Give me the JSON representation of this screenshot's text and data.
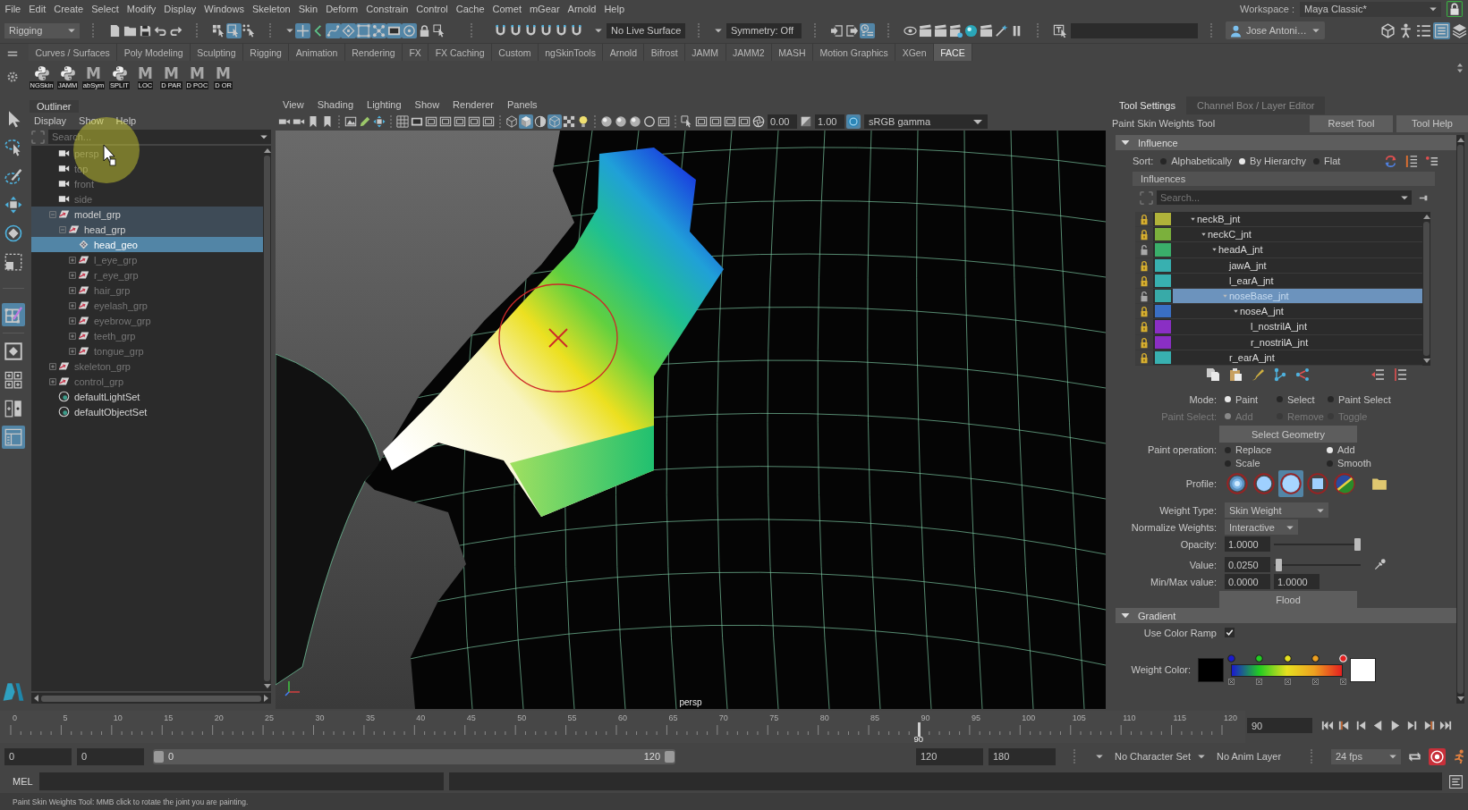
{
  "menu_bar": {
    "items": [
      "File",
      "Edit",
      "Create",
      "Select",
      "Modify",
      "Display",
      "Windows",
      "Skeleton",
      "Skin",
      "Deform",
      "Constrain",
      "Control",
      "Cache",
      "Comet",
      "mGear",
      "Arnold",
      "Help"
    ],
    "workspace_label": "Workspace :",
    "workspace": "Maya Classic*"
  },
  "status_line": {
    "menu_set": "Rigging",
    "selection_modes": [
      {
        "on": false
      },
      {
        "on": true
      },
      {
        "on": false
      }
    ],
    "mask_toggles": [
      {
        "on": true
      },
      {
        "on": false
      },
      {
        "on": true
      },
      {
        "on": true
      },
      {
        "on": true
      },
      {
        "on": true
      },
      {
        "on": true
      },
      {
        "on": true
      },
      {
        "on": false
      },
      {
        "on": false
      }
    ],
    "snap_toggles": [
      {
        "on": false
      },
      {
        "on": false
      },
      {
        "on": false
      },
      {
        "on": false
      },
      {
        "on": false
      },
      {
        "on": false
      }
    ],
    "live_surface": "No Live Surface",
    "symmetry": "Symmetry: Off",
    "history_toggles": [
      {
        "on": false
      },
      {
        "on": false
      },
      {
        "on": true
      }
    ],
    "user": "Jose Antoni…",
    "panel_toggles": [
      {
        "on": false
      },
      {
        "on": false
      },
      {
        "on": false
      },
      {
        "on": true
      },
      {
        "on": false
      }
    ]
  },
  "shelf": {
    "tabs": [
      {
        "label": "Curves / Surfaces",
        "selected": false
      },
      {
        "label": "Poly Modeling",
        "selected": false
      },
      {
        "label": "Sculpting",
        "selected": false
      },
      {
        "label": "Rigging",
        "selected": false
      },
      {
        "label": "Animation",
        "selected": false
      },
      {
        "label": "Rendering",
        "selected": false
      },
      {
        "label": "FX",
        "selected": false
      },
      {
        "label": "FX Caching",
        "selected": false
      },
      {
        "label": "Custom",
        "selected": false
      },
      {
        "label": "ngSkinTools",
        "selected": false
      },
      {
        "label": "Arnold",
        "selected": false
      },
      {
        "label": "Bifrost",
        "selected": false
      },
      {
        "label": "JAMM",
        "selected": false
      },
      {
        "label": "JAMM2",
        "selected": false
      },
      {
        "label": "MASH",
        "selected": false
      },
      {
        "label": "Motion Graphics",
        "selected": false
      },
      {
        "label": "XGen",
        "selected": false
      },
      {
        "label": "FACE",
        "selected": true
      }
    ],
    "buttons": [
      {
        "label": "NGSkin",
        "kind": "python"
      },
      {
        "label": "JAMM",
        "kind": "python"
      },
      {
        "label": "abSym",
        "kind": "mel",
        "glyph": "M"
      },
      {
        "label": "SPLIT",
        "kind": "python"
      },
      {
        "label": "LOC",
        "kind": "mel",
        "glyph": "M"
      },
      {
        "label": "D PAR",
        "kind": "mel",
        "glyph": "M"
      },
      {
        "label": "D POC",
        "kind": "mel",
        "glyph": "M"
      },
      {
        "label": "D OR",
        "kind": "mel",
        "glyph": "M"
      }
    ]
  },
  "toolbox": {
    "tools": [
      {
        "selected": false
      },
      {
        "selected": false
      },
      {
        "selected": false
      },
      {
        "selected": false
      },
      {
        "selected": false
      },
      {
        "selected": false
      },
      {
        "selected": true
      }
    ],
    "layouts": [
      {
        "selected": false
      },
      {
        "selected": false
      },
      {
        "selected": false
      },
      {
        "selected": true
      }
    ]
  },
  "outliner": {
    "title": "Outliner",
    "menu": [
      "Display",
      "Show",
      "Help"
    ],
    "search_placeholder": "Search...",
    "items": [
      {
        "name": "persp",
        "kind": "camera",
        "hidden": true,
        "selected": false,
        "highlighted": false
      },
      {
        "name": "top",
        "kind": "camera",
        "hidden": true,
        "selected": false,
        "highlighted": false
      },
      {
        "name": "front",
        "kind": "camera",
        "hidden": true,
        "selected": false,
        "highlighted": false
      },
      {
        "name": "side",
        "kind": "camera",
        "hidden": true,
        "selected": false,
        "highlighted": false
      },
      {
        "name": "model_grp",
        "kind": "group",
        "hidden": false,
        "selected": false,
        "highlighted": true,
        "expanded": true,
        "children": [
          {
            "name": "head_grp",
            "kind": "group",
            "hidden": false,
            "selected": false,
            "highlighted": true,
            "expanded": true,
            "children": [
              {
                "name": "head_geo",
                "kind": "mesh",
                "hidden": false,
                "selected": true,
                "highlighted": false
              },
              {
                "name": "l_eye_grp",
                "kind": "group",
                "hidden": true,
                "selected": false,
                "highlighted": false,
                "expanded": false
              },
              {
                "name": "r_eye_grp",
                "kind": "group",
                "hidden": true,
                "selected": false,
                "highlighted": false,
                "expanded": false
              },
              {
                "name": "hair_grp",
                "kind": "group",
                "hidden": true,
                "selected": false,
                "highlighted": false,
                "expanded": false
              },
              {
                "name": "eyelash_grp",
                "kind": "group",
                "hidden": true,
                "selected": false,
                "highlighted": false,
                "expanded": false
              },
              {
                "name": "eyebrow_grp",
                "kind": "group",
                "hidden": true,
                "selected": false,
                "highlighted": false,
                "expanded": false
              },
              {
                "name": "teeth_grp",
                "kind": "group",
                "hidden": true,
                "selected": false,
                "highlighted": false,
                "expanded": false
              },
              {
                "name": "tongue_grp",
                "kind": "group",
                "hidden": true,
                "selected": false,
                "highlighted": false,
                "expanded": false
              }
            ]
          }
        ]
      },
      {
        "name": "skeleton_grp",
        "kind": "group",
        "hidden": true,
        "selected": false,
        "highlighted": false,
        "expanded": false
      },
      {
        "name": "control_grp",
        "kind": "group",
        "hidden": true,
        "selected": false,
        "highlighted": false,
        "expanded": false
      },
      {
        "name": "defaultLightSet",
        "kind": "set",
        "hidden": false,
        "selected": false,
        "highlighted": false
      },
      {
        "name": "defaultObjectSet",
        "kind": "set",
        "hidden": false,
        "selected": false,
        "highlighted": false
      }
    ]
  },
  "viewport": {
    "menu": [
      "View",
      "Shading",
      "Lighting",
      "Show",
      "Renderer",
      "Panels"
    ],
    "toolbar_toggles": [
      {
        "on": false
      },
      {
        "on": false
      },
      {
        "on": false
      },
      {
        "on": false
      },
      {
        "on": false
      },
      {
        "on": false
      },
      {
        "on": false
      },
      {
        "on": false
      },
      {
        "on": false
      },
      {
        "on": false
      },
      {
        "on": false
      },
      {
        "on": false
      },
      {
        "on": false
      },
      {
        "on": false
      },
      {
        "on": false
      },
      {
        "on": true
      },
      {
        "on": false
      },
      {
        "on": true
      },
      {
        "on": false
      },
      {
        "on": false
      },
      {
        "on": false
      },
      {
        "on": false
      },
      {
        "on": false
      },
      {
        "on": false
      },
      {
        "on": false
      },
      {
        "on": false
      },
      {
        "on": false
      },
      {
        "on": false
      },
      {
        "on": false
      },
      {
        "on": false
      },
      {
        "on": false
      }
    ],
    "exposure": "0.00",
    "gamma": "1.00",
    "color_management": true,
    "color_space": "sRGB gamma",
    "camera": "persp"
  },
  "tool_settings": {
    "tabs": [
      {
        "label": "Tool Settings",
        "selected": true
      },
      {
        "label": "Channel Box / Layer Editor",
        "selected": false
      }
    ],
    "tool_name": "Paint Skin Weights Tool",
    "buttons": [
      "Reset Tool",
      "Tool Help"
    ],
    "influence": {
      "title": "Influence",
      "expanded": true,
      "sort_label": "Sort:",
      "sort_options": [
        {
          "label": "Alphabetically",
          "selected": false
        },
        {
          "label": "By Hierarchy",
          "selected": true
        },
        {
          "label": "Flat",
          "selected": false
        }
      ],
      "list_title": "Influences",
      "search_placeholder": "Search...",
      "joints": [
        {
          "name": "neckB_jnt",
          "locked": true,
          "color": "#b0b33a",
          "selected": false,
          "expanded": true,
          "children": [
            {
              "name": "neckC_jnt",
              "locked": true,
              "color": "#7bb03c",
              "selected": false,
              "expanded": true,
              "children": [
                {
                  "name": "headA_jnt",
                  "locked": false,
                  "color": "#3aae6a",
                  "selected": false,
                  "expanded": true,
                  "children": [
                    {
                      "name": "jawA_jnt",
                      "locked": true,
                      "color": "#38b0b0",
                      "selected": false
                    },
                    {
                      "name": "l_earA_jnt",
                      "locked": true,
                      "color": "#38b0b0",
                      "selected": false
                    },
                    {
                      "name": "noseBase_jnt",
                      "locked": false,
                      "color": "#38aaa8",
                      "selected": true,
                      "expanded": true,
                      "children": [
                        {
                          "name": "noseA_jnt",
                          "locked": true,
                          "color": "#3a6fc4",
                          "selected": false,
                          "expanded": true,
                          "children": [
                            {
                              "name": "l_nostrilA_jnt",
                              "locked": true,
                              "color": "#8a2fc4",
                              "selected": false
                            },
                            {
                              "name": "r_nostrilA_jnt",
                              "locked": true,
                              "color": "#8a2fc4",
                              "selected": false
                            }
                          ]
                        }
                      ]
                    },
                    {
                      "name": "r_earA_jnt",
                      "locked": true,
                      "color": "#38b0b0",
                      "selected": false
                    }
                  ]
                }
              ]
            }
          ]
        }
      ],
      "mode": {
        "label": "Mode:",
        "options": [
          {
            "label": "Paint",
            "selected": true
          },
          {
            "label": "Select",
            "selected": false
          },
          {
            "label": "Paint Select",
            "selected": false
          }
        ]
      },
      "paint_select": {
        "label": "Paint Select:",
        "disabled": true,
        "options": [
          {
            "label": "Add",
            "selected": true
          },
          {
            "label": "Remove",
            "selected": false
          },
          {
            "label": "Toggle",
            "selected": false
          }
        ]
      },
      "select_geometry": "Select Geometry",
      "paint_operation": {
        "label": "Paint operation:",
        "options": [
          {
            "label": "Replace",
            "selected": false
          },
          {
            "label": "Add",
            "selected": true
          },
          {
            "label": "Scale",
            "selected": false
          },
          {
            "label": "Smooth",
            "selected": false
          }
        ]
      },
      "profile": {
        "label": "Profile:",
        "brushes": [
          {
            "selected": false
          },
          {
            "selected": false
          },
          {
            "selected": true
          },
          {
            "selected": false
          }
        ]
      },
      "weight_type": {
        "label": "Weight Type:",
        "value": "Skin Weight"
      },
      "normalize_weights": {
        "label": "Normalize Weights:",
        "value": "Interactive"
      },
      "opacity": {
        "label": "Opacity:",
        "value": "1.0000",
        "level": 1
      },
      "value": {
        "label": "Value:",
        "value": "0.0250",
        "level": 0.025
      },
      "min_max": {
        "label": "Min/Max value:",
        "min": "0.0000",
        "max": "1.0000"
      },
      "flood": "Flood"
    },
    "gradient": {
      "title": "Gradient",
      "expanded": true,
      "use_color_ramp": {
        "label": "Use Color Ramp",
        "checked": true
      },
      "weight_color_label": "Weight Color:",
      "ramp_markers": [
        {
          "color": "#1a1ad0",
          "selected": false
        },
        {
          "color": "#22cc22",
          "selected": false
        },
        {
          "color": "#e6e020",
          "selected": false
        },
        {
          "color": "#eea020",
          "selected": false
        },
        {
          "color": "#e42020",
          "selected": true
        }
      ]
    }
  },
  "timeline": {
    "tick_labels": [
      "0",
      "5",
      "10",
      "15",
      "20",
      "25",
      "30",
      "35",
      "40",
      "45",
      "50",
      "55",
      "60",
      "65",
      "70",
      "75",
      "80",
      "85",
      "90",
      "95",
      "100",
      "105",
      "110",
      "115",
      "120"
    ],
    "level": 0.75,
    "current_frame": "90",
    "frame_field": "90"
  },
  "range": {
    "animation_start": "0",
    "playback_start": "0",
    "slider": {
      "start": "0",
      "end": "120",
      "level": 1
    },
    "playback_end": "120",
    "animation_end": "180",
    "character_set": "No Character Set",
    "anim_layer": "No Anim Layer",
    "fps": "24 fps",
    "auto_key": true
  },
  "command_line": {
    "label": "MEL"
  },
  "help_line": "Paint Skin Weights Tool: MMB click to rotate the joint you are painting."
}
